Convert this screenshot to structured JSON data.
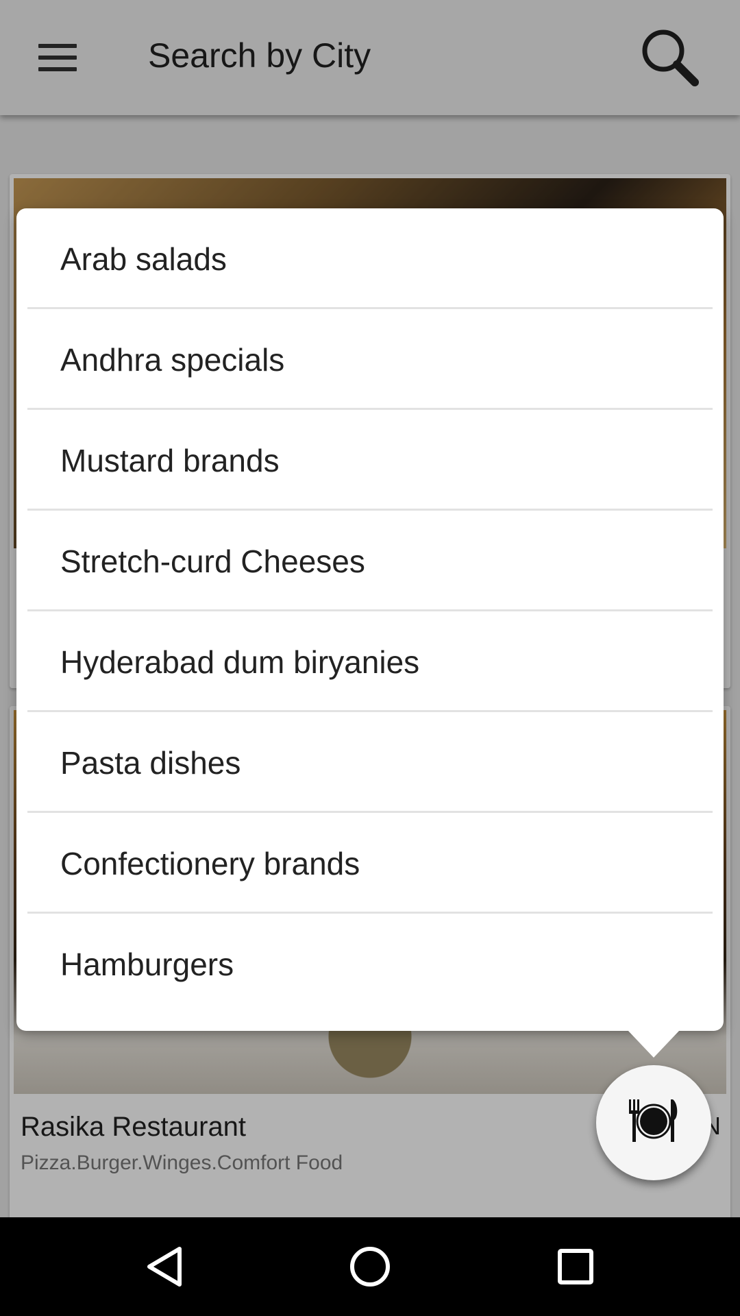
{
  "toolbar": {
    "title": "Search by City",
    "menu_icon": "hamburger-menu-icon",
    "search_icon": "search-icon"
  },
  "cards": [
    {
      "name": "",
      "tags": ""
    },
    {
      "name": "Rasika Restaurant",
      "tags": "Pizza.Burger.Winges.Comfort Food",
      "side_text": "N"
    }
  ],
  "popup": {
    "items": [
      "Arab salads",
      "Andhra specials",
      "Mustard brands",
      "Stretch-curd Cheeses",
      "Hyderabad dum biryanies",
      "Pasta dishes",
      "Confectionery brands",
      "Hamburgers"
    ]
  },
  "fab": {
    "icon": "plate-fork-knife-icon"
  },
  "navbar": {
    "back_icon": "back-icon",
    "home_icon": "home-icon",
    "recents_icon": "recents-icon"
  }
}
